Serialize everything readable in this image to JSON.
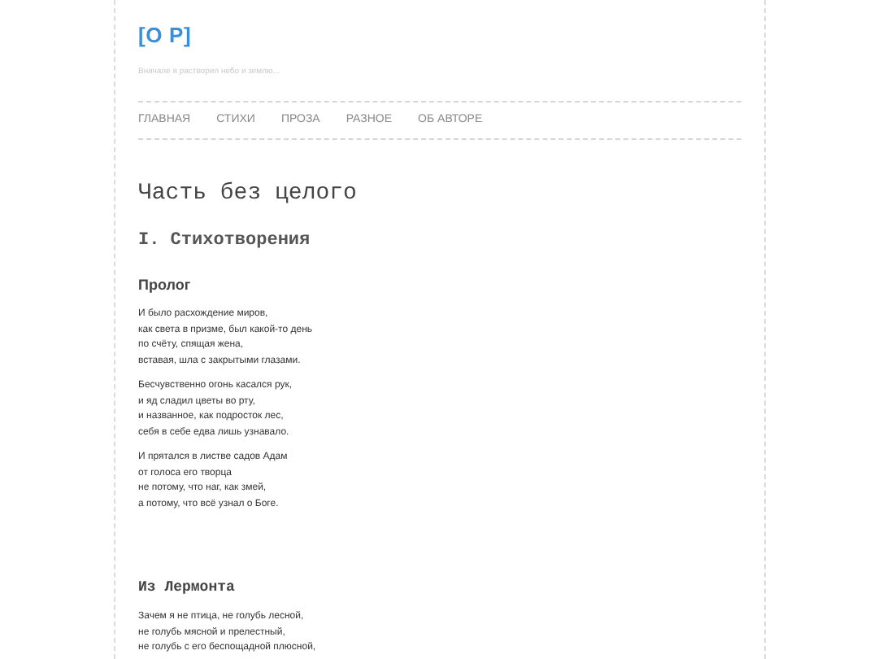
{
  "site": {
    "logo": "[O P]",
    "tagline": "Вначале я растворил небо и землю..."
  },
  "nav": [
    {
      "label": "ГЛАВНАЯ"
    },
    {
      "label": "СТИХИ"
    },
    {
      "label": "ПРОЗА"
    },
    {
      "label": "РАЗНОЕ"
    },
    {
      "label": "ОБ АВТОРЕ"
    }
  ],
  "title": "Часть без целого",
  "section": "I. Стихотворения",
  "poems": [
    {
      "title": "Пролог",
      "stanzas": [
        [
          "И было расхождение миров,",
          "как света в призме, был какой-то день",
          "по счёту, спящая жена,",
          "вставая, шла с закрытыми глазами."
        ],
        [
          "Бесчувственно огонь касался рук,",
          "и яд сладил цветы во рту,",
          "и названное, как подросток лес,",
          "себя в себе едва лишь узнавало."
        ],
        [
          "И прятался в листве садов Адам",
          "от голоса его творца",
          "не потому, что наг, как змей,",
          "а потому, что всё узнал о Боге."
        ]
      ]
    },
    {
      "title": "Из Лермонта",
      "stanzas": [
        [
          "Зачем я не птица, не голубь лесной,",
          "не голубь мясной и прелестный,",
          "не голубь с его беспощадной плюсной,"
        ]
      ]
    }
  ]
}
